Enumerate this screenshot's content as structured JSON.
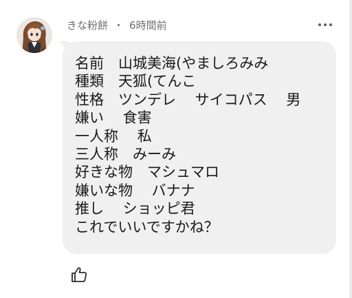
{
  "comment": {
    "author": "きな粉餅",
    "separator": "・",
    "timestamp": "6時間前",
    "lines": [
      "名前　山城美海(やましろみみ",
      "種類　天狐(てんこ",
      "性格　ツンデレ　 サイコパス　 男",
      "嫌い　 食害",
      "一人称　 私",
      "三人称　みーみ",
      "好きな物　マシュマロ",
      "嫌いな物　 バナナ",
      "推し　 ショッピ君",
      "これでいいですかね？"
    ]
  },
  "icons": {
    "avatar": "avatar-image",
    "more": "more-horizontal-icon",
    "like": "thumbs-up-icon"
  },
  "colors": {
    "bubble_background": "#f0f0f0",
    "meta_text": "#6f6f6f",
    "body_text": "#1a1a1a"
  }
}
